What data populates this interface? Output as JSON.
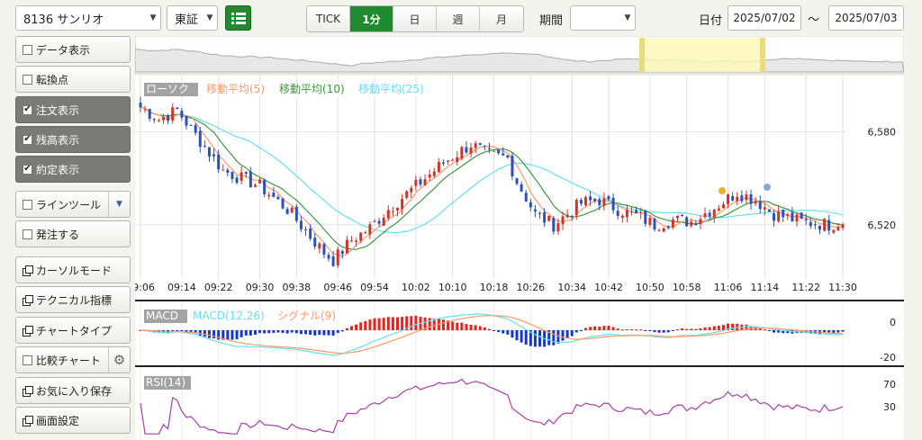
{
  "toolbar": {
    "stock": "8136 サンリオ",
    "market": "東証",
    "tabs": [
      {
        "label": "TICK",
        "active": false
      },
      {
        "label": "1分",
        "active": true
      },
      {
        "label": "日",
        "active": false
      },
      {
        "label": "週",
        "active": false
      },
      {
        "label": "月",
        "active": false
      }
    ],
    "period_label": "期間",
    "period_value": "",
    "date_label": "日付",
    "date_from": "2025/07/02",
    "tilde": "〜",
    "date_to": "2025/07/03"
  },
  "sidebar": {
    "items": [
      {
        "label": "データ表示",
        "kind": "check",
        "checked": false,
        "dark": false
      },
      {
        "label": "転換点",
        "kind": "check",
        "checked": false,
        "dark": false
      },
      {
        "label": "注文表示",
        "kind": "check",
        "checked": true,
        "dark": true
      },
      {
        "label": "残高表示",
        "kind": "check",
        "checked": true,
        "dark": true
      },
      {
        "label": "約定表示",
        "kind": "check",
        "checked": true,
        "dark": true
      },
      {
        "label": "ラインツール",
        "kind": "check-dropdown",
        "checked": false,
        "dark": false
      },
      {
        "label": "発注する",
        "kind": "check",
        "checked": false,
        "dark": false
      },
      {
        "label": "カーソルモード",
        "kind": "window",
        "dark": false
      },
      {
        "label": "テクニカル指標",
        "kind": "window",
        "dark": false
      },
      {
        "label": "チャートタイプ",
        "kind": "window",
        "dark": false
      },
      {
        "label": "比較チャート",
        "kind": "check-gear",
        "checked": false,
        "dark": false
      },
      {
        "label": "お気に入り保存",
        "kind": "window",
        "dark": false
      },
      {
        "label": "画面設定",
        "kind": "window",
        "dark": false
      }
    ]
  },
  "colors": {
    "up": "#d0342c",
    "down": "#2a52be",
    "ma5": "#ff9966",
    "ma10": "#3d9a3d",
    "ma25": "#66e0f0",
    "macd_line": "#66e0f0",
    "signal_line": "#ff9966",
    "rsi": "#a83eaa",
    "highlight": "#fff8b8",
    "accent": "#1f8a2e"
  },
  "chart_data": [
    {
      "type": "line",
      "name": "overview",
      "note": "navigator"
    },
    {
      "type": "candlestick",
      "legend": [
        "ローソク",
        "移動平均(5)",
        "移動平均(10)",
        "移動平均(25)"
      ],
      "x_ticks": [
        "09:06",
        "09:14",
        "09:22",
        "09:30",
        "09:38",
        "09:46",
        "09:54",
        "10:02",
        "10:10",
        "10:18",
        "10:26",
        "10:34",
        "10:42",
        "10:50",
        "10:58",
        "11:06",
        "11:14",
        "11:22",
        "11:30"
      ],
      "y_ticks": [
        "6,580",
        "6,520"
      ],
      "ylim": [
        6485,
        6610
      ],
      "series": [
        {
          "name": "ローソク",
          "waypoints": [
            [
              0,
              6596
            ],
            [
              4,
              6588
            ],
            [
              8,
              6594
            ],
            [
              12,
              6578
            ],
            [
              18,
              6555
            ],
            [
              26,
              6545
            ],
            [
              32,
              6530
            ],
            [
              36,
              6516
            ],
            [
              40,
              6502
            ],
            [
              42,
              6497
            ],
            [
              46,
              6510
            ],
            [
              50,
              6518
            ],
            [
              54,
              6530
            ],
            [
              60,
              6545
            ],
            [
              66,
              6560
            ],
            [
              72,
              6572
            ],
            [
              76,
              6565
            ],
            [
              80,
              6563
            ],
            [
              82,
              6548
            ],
            [
              86,
              6527
            ],
            [
              90,
              6520
            ],
            [
              96,
              6534
            ],
            [
              100,
              6536
            ],
            [
              104,
              6530
            ],
            [
              108,
              6526
            ],
            [
              112,
              6520
            ],
            [
              116,
              6523
            ],
            [
              120,
              6522
            ],
            [
              126,
              6533
            ],
            [
              130,
              6541
            ],
            [
              134,
              6536
            ],
            [
              138,
              6527
            ],
            [
              144,
              6522
            ],
            [
              150,
              6520
            ],
            [
              153,
              6522
            ]
          ]
        }
      ]
    },
    {
      "type": "bar",
      "name": "MACD",
      "legend": [
        "MACD",
        "MACD(12,26)",
        "シグナル(9)"
      ],
      "y_ticks": [
        "0",
        "-20"
      ]
    },
    {
      "type": "line",
      "name": "RSI",
      "legend": [
        "RSI(14)"
      ],
      "y_ticks": [
        "70",
        "30"
      ]
    }
  ]
}
